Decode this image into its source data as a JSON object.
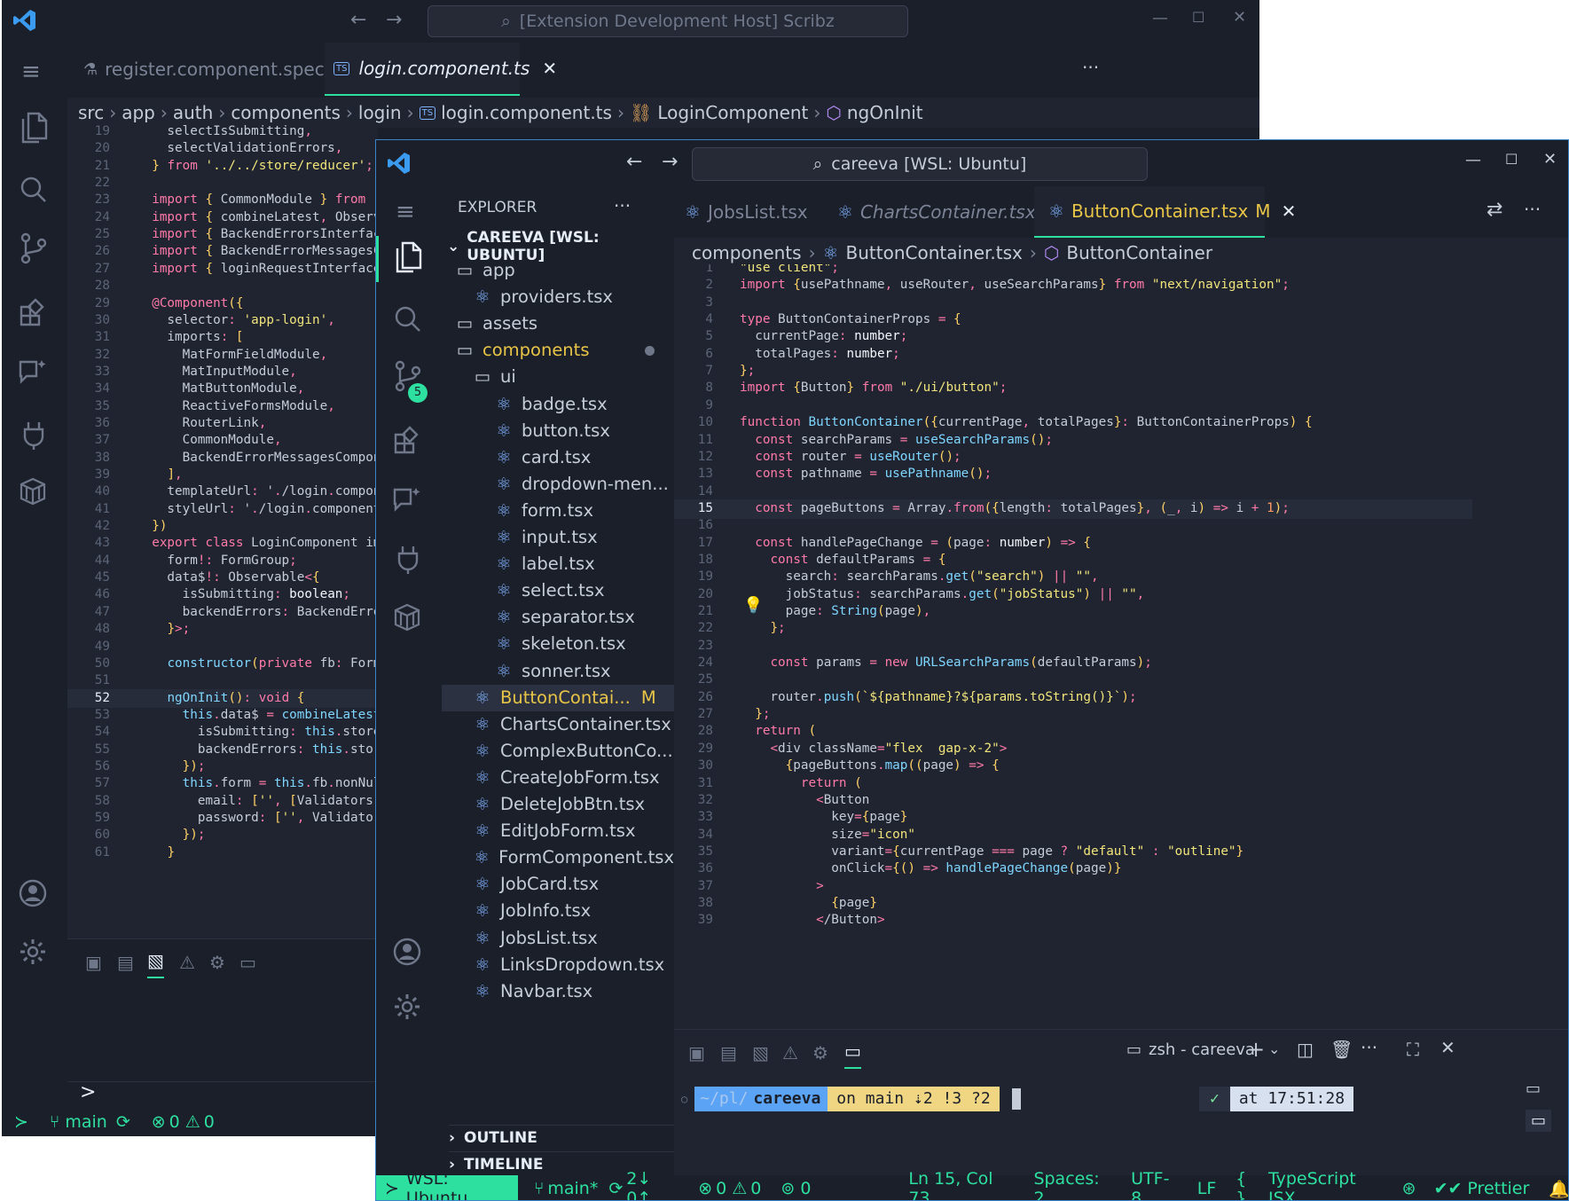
{
  "back_window": {
    "search_text": "[Extension Development Host] Scribz",
    "tabs": [
      {
        "label": "register.component.spec.ts",
        "active": false
      },
      {
        "label": "login.component.ts",
        "active": true
      }
    ],
    "breadcrumb": [
      "src",
      "app",
      "auth",
      "components",
      "login",
      "login.component.ts",
      "LoginComponent",
      "ngOnInit"
    ],
    "code_lines": [
      {
        "n": "19",
        "text": "    selectIsSubmitting,"
      },
      {
        "n": "20",
        "text": "    selectValidationErrors,"
      },
      {
        "n": "21",
        "text": "  } from '../../store/reducer';"
      },
      {
        "n": "22",
        "text": ""
      },
      {
        "n": "23",
        "text": "  import { CommonModule } from '@a"
      },
      {
        "n": "24",
        "text": "  import { combineLatest, Observab"
      },
      {
        "n": "25",
        "text": "  import { BackendErrorsInterface"
      },
      {
        "n": "26",
        "text": "  import { BackendErrorMessagesCom"
      },
      {
        "n": "27",
        "text": "  import { loginRequestInterface }"
      },
      {
        "n": "28",
        "text": ""
      },
      {
        "n": "29",
        "text": "  @Component({"
      },
      {
        "n": "30",
        "text": "    selector: 'app-login',"
      },
      {
        "n": "31",
        "text": "    imports: ["
      },
      {
        "n": "32",
        "text": "      MatFormFieldModule,"
      },
      {
        "n": "33",
        "text": "      MatInputModule,"
      },
      {
        "n": "34",
        "text": "      MatButtonModule,"
      },
      {
        "n": "35",
        "text": "      ReactiveFormsModule,"
      },
      {
        "n": "36",
        "text": "      RouterLink,"
      },
      {
        "n": "37",
        "text": "      CommonModule,"
      },
      {
        "n": "38",
        "text": "      BackendErrorMessagesComponen"
      },
      {
        "n": "39",
        "text": "    ],"
      },
      {
        "n": "40",
        "text": "    templateUrl: './login.componen"
      },
      {
        "n": "41",
        "text": "    styleUrl: './login.component.s"
      },
      {
        "n": "42",
        "text": "  })"
      },
      {
        "n": "43",
        "text": "  export class LoginComponent impl"
      },
      {
        "n": "44",
        "text": "    form!: FormGroup;"
      },
      {
        "n": "45",
        "text": "    data$!: Observable<{"
      },
      {
        "n": "46",
        "text": "      isSubmitting: boolean;"
      },
      {
        "n": "47",
        "text": "      backendErrors: BackendErrors"
      },
      {
        "n": "48",
        "text": "    }>;"
      },
      {
        "n": "49",
        "text": ""
      },
      {
        "n": "50",
        "text": "    constructor(private fb: FormBu"
      },
      {
        "n": "51",
        "text": ""
      },
      {
        "n": "52",
        "text": "    ngOnInit(): void {"
      },
      {
        "n": "53",
        "text": "      this.data$ = combineLatest({"
      },
      {
        "n": "54",
        "text": "        isSubmitting: this.store.s"
      },
      {
        "n": "55",
        "text": "        backendErrors: this.store"
      },
      {
        "n": "56",
        "text": "      });"
      },
      {
        "n": "57",
        "text": "      this.form = this.fb.nonNulla"
      },
      {
        "n": "58",
        "text": "        email: ['', [Validators.re"
      },
      {
        "n": "59",
        "text": "        password: ['', Validators"
      },
      {
        "n": "60",
        "text": "      });"
      },
      {
        "n": "61",
        "text": "    }"
      }
    ],
    "current_line": "52",
    "panel_prompt": ">",
    "status": {
      "branch": "main",
      "errors": "0",
      "warnings": "0"
    }
  },
  "front_window": {
    "search_text": "careeva [WSL: Ubuntu]",
    "explorer": {
      "title": "EXPLORER",
      "root": "CAREEVA [WSL: UBUNTU]",
      "items": [
        {
          "label": "app",
          "type": "folder"
        },
        {
          "label": "providers.tsx",
          "type": "react"
        },
        {
          "label": "assets",
          "type": "folder"
        },
        {
          "label": "components",
          "type": "folder",
          "modified": true
        },
        {
          "label": "ui",
          "type": "folder"
        },
        {
          "label": "badge.tsx",
          "type": "react"
        },
        {
          "label": "button.tsx",
          "type": "react"
        },
        {
          "label": "card.tsx",
          "type": "react"
        },
        {
          "label": "dropdown-men...",
          "type": "react"
        },
        {
          "label": "form.tsx",
          "type": "react"
        },
        {
          "label": "input.tsx",
          "type": "react"
        },
        {
          "label": "label.tsx",
          "type": "react"
        },
        {
          "label": "select.tsx",
          "type": "react"
        },
        {
          "label": "separator.tsx",
          "type": "react"
        },
        {
          "label": "skeleton.tsx",
          "type": "react"
        },
        {
          "label": "sonner.tsx",
          "type": "react"
        },
        {
          "label": "ButtonContai...",
          "type": "react",
          "badge": "M",
          "selected": true
        },
        {
          "label": "ChartsContainer.tsx",
          "type": "react"
        },
        {
          "label": "ComplexButtonCo...",
          "type": "react"
        },
        {
          "label": "CreateJobForm.tsx",
          "type": "react"
        },
        {
          "label": "DeleteJobBtn.tsx",
          "type": "react"
        },
        {
          "label": "EditJobForm.tsx",
          "type": "react"
        },
        {
          "label": "FormComponent.tsx",
          "type": "react"
        },
        {
          "label": "JobCard.tsx",
          "type": "react"
        },
        {
          "label": "JobInfo.tsx",
          "type": "react"
        },
        {
          "label": "JobsList.tsx",
          "type": "react"
        },
        {
          "label": "LinksDropdown.tsx",
          "type": "react"
        },
        {
          "label": "Navbar.tsx",
          "type": "react"
        }
      ],
      "outline": "OUTLINE",
      "timeline": "TIMELINE"
    },
    "scm_badge": "5",
    "tabs": [
      {
        "label": "JobsList.tsx",
        "active": false
      },
      {
        "label": "ChartsContainer.tsx",
        "active": false
      },
      {
        "label": "ButtonContainer.tsx",
        "active": true,
        "badge": "M"
      }
    ],
    "breadcrumb": [
      "components",
      "ButtonContainer.tsx",
      "ButtonContainer"
    ],
    "current_line": "15",
    "terminal": {
      "name": "zsh - careeva",
      "path_dim": "~/pl/",
      "path": "careeva",
      "git": "on main ⇣2 !3 ?2",
      "check": "✓",
      "time": "at 17:51:28"
    },
    "status": {
      "remote": "WSL: Ubuntu",
      "branch": "main*",
      "sync": "2↓ 0↑",
      "errors": "0",
      "warnings": "0",
      "ports": "0",
      "position": "Ln 15, Col 73",
      "spaces": "Spaces: 2",
      "encoding": "UTF-8",
      "eol": "LF",
      "language": "TypeScript JSX",
      "formatter": "Prettier"
    }
  },
  "colors": {
    "accent": "#2ee0a0",
    "bg": "#1f2430",
    "bar": "#1b1f29",
    "keyword": "#ff7aa8",
    "string": "#f1e47b",
    "func": "#7fd6ff"
  }
}
